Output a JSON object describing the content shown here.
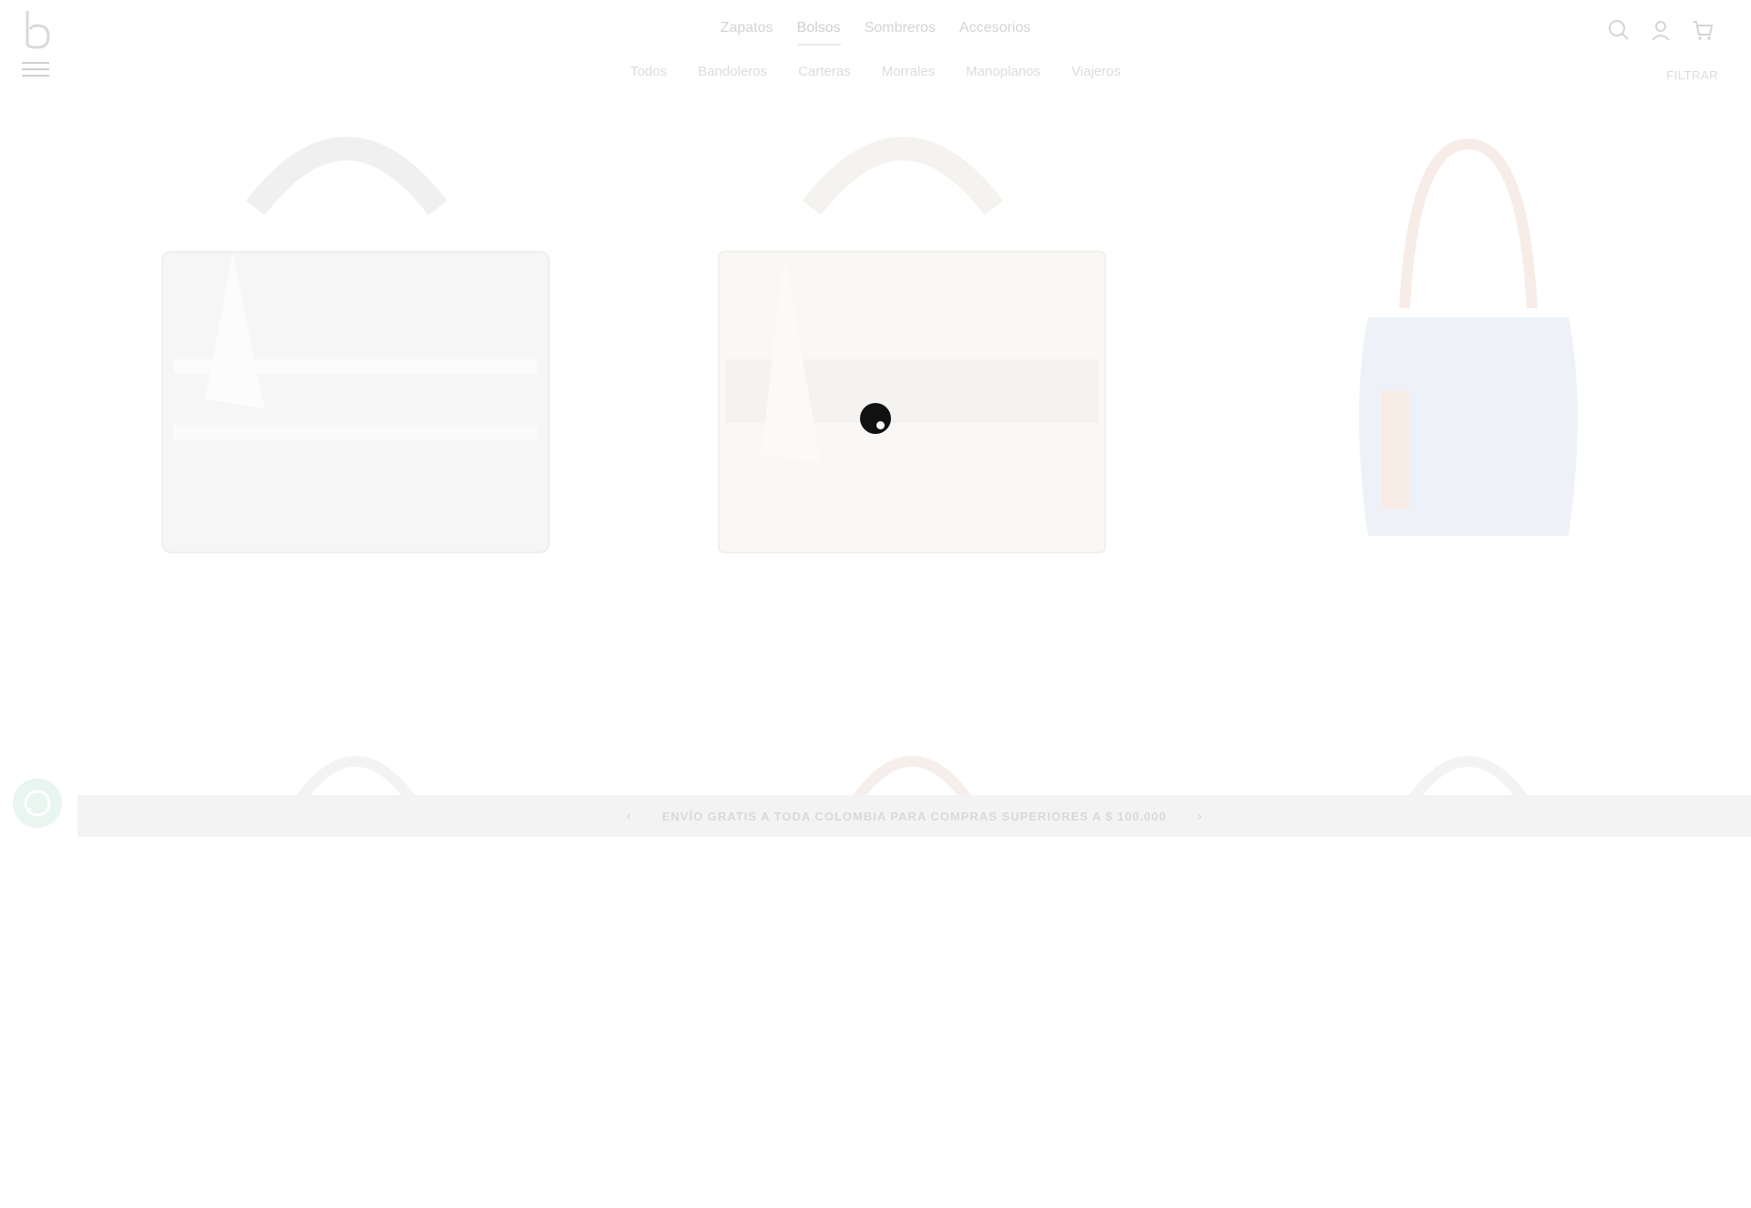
{
  "brand": {
    "logo_letter": "b"
  },
  "main_nav": [
    {
      "label": "Zapatos",
      "active": false
    },
    {
      "label": "Bolsos",
      "active": true
    },
    {
      "label": "Sombreros",
      "active": false
    },
    {
      "label": "Accesorios",
      "active": false
    }
  ],
  "sub_nav": [
    {
      "label": "Todos"
    },
    {
      "label": "Bandoleros"
    },
    {
      "label": "Carteras"
    },
    {
      "label": "Morrales"
    },
    {
      "label": "Manoplanos"
    },
    {
      "label": "Viajeros"
    }
  ],
  "filter": {
    "label": "FILTRAR"
  },
  "header_icons": [
    "search-icon",
    "account-icon",
    "cart-icon"
  ],
  "announcement": {
    "prev": "‹",
    "message": "ENVÍO GRATIS A TODA COLOMBIA PARA COMPRAS SUPERIORES A $ 100.000",
    "next": "›"
  },
  "colors": {
    "accent_loader": "#111111",
    "bag_blue": "#dfe7f3",
    "bag_grey": "#eeeeee",
    "whatsapp_bg": "#e9f5ef"
  }
}
